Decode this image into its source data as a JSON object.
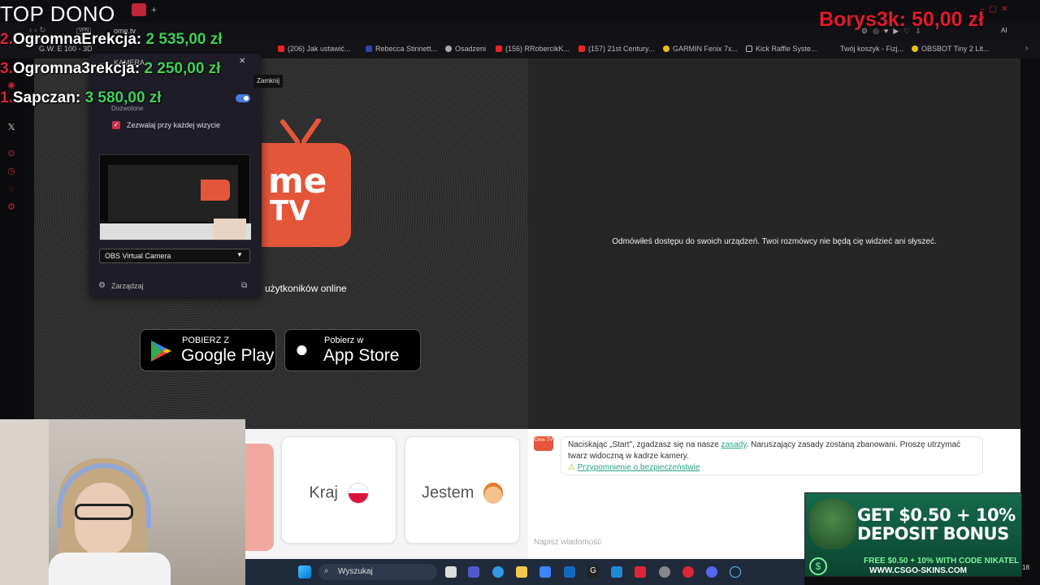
{
  "browser": {
    "url": "ome.tv",
    "vpn_label": "VPN",
    "bookmarks": [
      {
        "label": "G.W. E 100 - 3D"
      },
      {
        "label": "(206) Jak ustawić..."
      },
      {
        "label": "Rebecca Stinnett..."
      },
      {
        "label": "Osadzeni"
      },
      {
        "label": "(156) RRobercikK..."
      },
      {
        "label": "(157) 21st Century..."
      },
      {
        "label": "GARMIN Fenix 7x..."
      },
      {
        "label": "Kick Raffle Syste..."
      },
      {
        "label": "Twój koszyk - Fizj..."
      },
      {
        "label": "OBSBOT Tiny 2 Lit..."
      }
    ]
  },
  "overlay": {
    "top_dono_title": "TOP DONO",
    "donations": [
      {
        "rank": "2.",
        "name": "OgromnaErekcja: ",
        "amount": "2 535,00 zł"
      },
      {
        "rank": "3.",
        "name": "Ogromna3rekcja: ",
        "amount": "2 250,00 zł"
      },
      {
        "rank": "1.",
        "name": "Sapczan: ",
        "amount": "3 580,00 zł"
      }
    ],
    "latest_donation": "Borys3k: 50,00 zł"
  },
  "camera_popup": {
    "title": "KAMERA",
    "close_tooltip": "Zamknij",
    "status": "Dozwolone",
    "checkbox_label": "Zezwalaj przy każdej wizycie",
    "checkbox_checked": true,
    "toggle_on": true,
    "selected_camera": "OBS Virtual Camera",
    "manage_label": "Zarządzaj"
  },
  "page": {
    "logo_line1": "me",
    "logo_line2": "TV",
    "users_online": "użytkoników online",
    "google_play": {
      "small": "POBIERZ Z",
      "big": "Google Play"
    },
    "app_store": {
      "small": "Pobierz w",
      "big": "App Store"
    },
    "denied_message": "Odmówiłeś dostępu do swoich urządzeń. Twoi rozmówcy nie będą cię widzieć ani słyszeć.",
    "country_label": "Kraj",
    "gender_label": "Jestem",
    "notice_prefix": "Naciskając „Start\", zgadzasz się na nasze ",
    "notice_link": "zasady",
    "notice_suffix": ". Naruszający zasady zostaną zbanowani. Proszę utrzymać twarz widoczną w kadrze kamery.",
    "safety_link": "Przypomnienie o bezpieczeństwie",
    "message_placeholder": "Napisz wiadomość",
    "ome_mini": "Ome TV"
  },
  "ad": {
    "headline1": "GET $0.50 + 10%",
    "headline2": "DEPOSIT BONUS",
    "line1": "FREE $0.50 + 10% WITH CODE NIKATEL",
    "line2": "WWW.CSGO-SKINS.COM"
  },
  "taskbar": {
    "search_label": "Wyszukaj",
    "clock": "18"
  },
  "colors": {
    "ome_orange": "#e4563a",
    "dono_red": "#e01b2c",
    "dono_green": "#3fd15a",
    "link_teal": "#2aa38a"
  }
}
